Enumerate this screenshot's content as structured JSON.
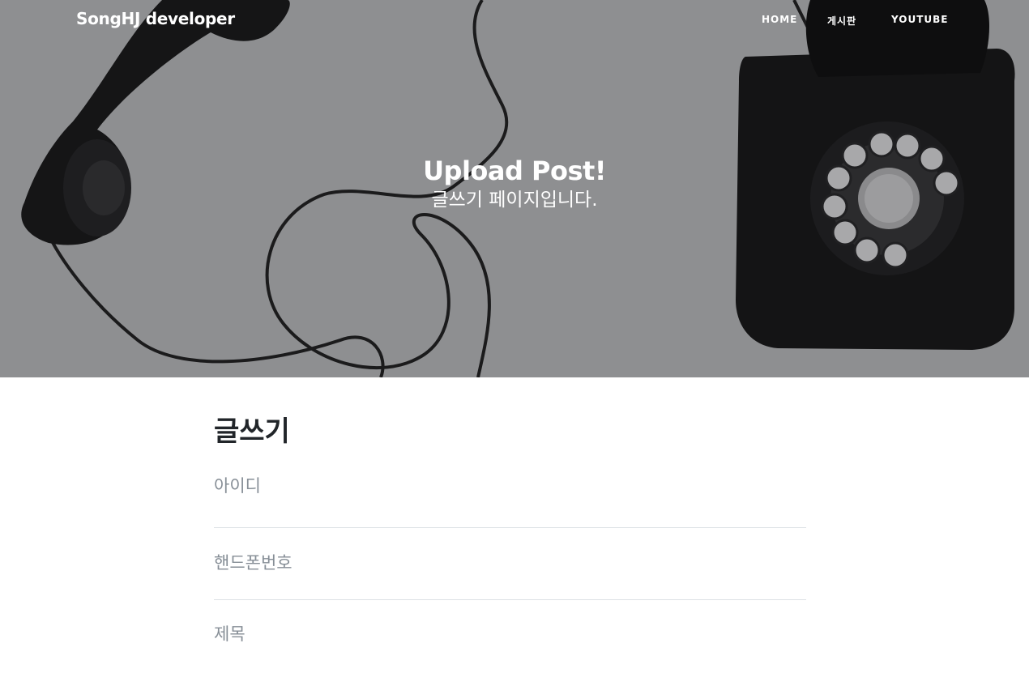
{
  "navbar": {
    "brand": "SongHJ developer",
    "links": [
      {
        "label": "HOME"
      },
      {
        "label": "게시판"
      },
      {
        "label": "YOUTUBE"
      }
    ]
  },
  "hero": {
    "title": "Upload Post!",
    "subtitle": "글쓰기 페이지입니다.",
    "background_image": "rotary-telephone-photo",
    "overlay_color": "#8d8e90"
  },
  "form": {
    "heading": "글쓰기",
    "fields": [
      {
        "placeholder": "아이디",
        "value": ""
      },
      {
        "placeholder": "핸드폰번호",
        "value": ""
      },
      {
        "placeholder": "제목",
        "value": ""
      }
    ]
  },
  "colors": {
    "heading": "#212529",
    "placeholder": "#868e96",
    "divider": "#dee2e6"
  }
}
